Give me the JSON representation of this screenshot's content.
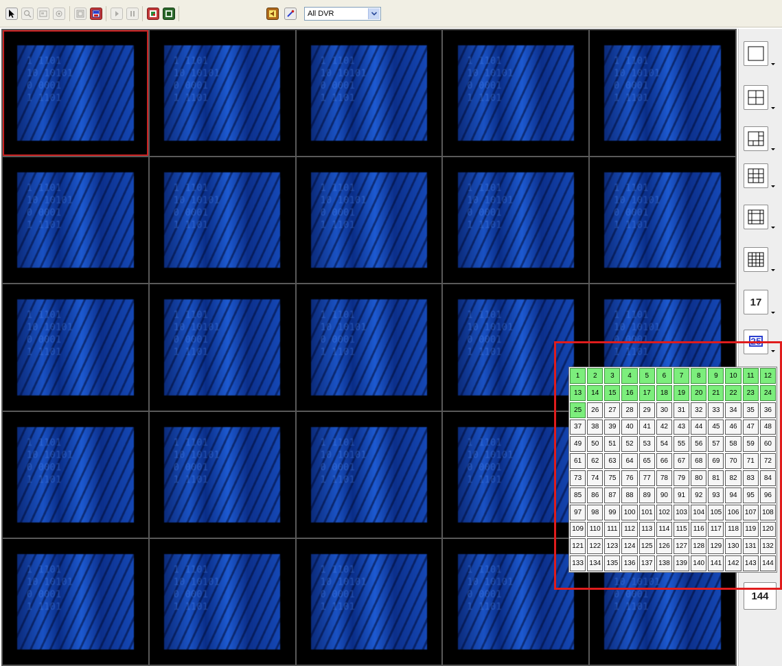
{
  "toolbar": {
    "buttons": [
      {
        "name": "select-pointer-icon",
        "state": "active"
      },
      {
        "name": "zoom-icon",
        "state": "disabled"
      },
      {
        "name": "snapshot-icon",
        "state": "disabled"
      },
      {
        "name": "ptz-icon",
        "state": "disabled"
      },
      {
        "name": "full-screen-icon",
        "state": "disabled"
      },
      {
        "name": "multi-screen-icon",
        "state": "active"
      },
      {
        "name": "play-icon",
        "state": "disabled"
      },
      {
        "name": "pause-icon",
        "state": "disabled"
      },
      {
        "name": "record-icon",
        "state": "active"
      },
      {
        "name": "save-icon",
        "state": "active"
      },
      {
        "name": "audio-icon",
        "state": "active"
      },
      {
        "name": "settings-icon",
        "state": "active"
      }
    ],
    "dvr_select": {
      "value": "All DVR"
    }
  },
  "camera_grid": {
    "rows": 5,
    "columns": 5,
    "selected_cell": 1,
    "feed_text": "1 1101\n10 10101\n0 0001\n1 1101"
  },
  "layout_panel": {
    "buttons": [
      {
        "name": "layout-1-button",
        "icon": "single-view-icon"
      },
      {
        "name": "layout-4-button",
        "icon": "quad-view-icon"
      },
      {
        "name": "layout-6-button",
        "icon": "six-view-icon"
      },
      {
        "name": "layout-9-button",
        "icon": "nine-view-icon"
      },
      {
        "name": "layout-13-button",
        "icon": "thirteen-view-icon"
      },
      {
        "name": "layout-16-button",
        "icon": "sixteen-view-icon"
      },
      {
        "name": "layout-17-button",
        "label": "17"
      },
      {
        "name": "layout-25-button",
        "label": "25"
      },
      {
        "name": "layout-144-button",
        "label": "144"
      }
    ]
  },
  "channel_picker": {
    "columns": 12,
    "active_count": 25,
    "channels": [
      "1",
      "2",
      "3",
      "4",
      "5",
      "6",
      "7",
      "8",
      "9",
      "10",
      "11",
      "12",
      "13",
      "14",
      "15",
      "16",
      "17",
      "18",
      "19",
      "20",
      "21",
      "22",
      "23",
      "24",
      "25",
      "26",
      "27",
      "28",
      "29",
      "30",
      "31",
      "32",
      "33",
      "34",
      "35",
      "36",
      "37",
      "38",
      "39",
      "40",
      "41",
      "42",
      "43",
      "44",
      "45",
      "46",
      "47",
      "48",
      "49",
      "50",
      "51",
      "52",
      "53",
      "54",
      "55",
      "56",
      "57",
      "58",
      "59",
      "60",
      "61",
      "62",
      "63",
      "64",
      "65",
      "66",
      "67",
      "68",
      "69",
      "70",
      "71",
      "72",
      "73",
      "74",
      "75",
      "76",
      "77",
      "78",
      "79",
      "80",
      "81",
      "82",
      "83",
      "84",
      "85",
      "86",
      "87",
      "88",
      "89",
      "90",
      "91",
      "92",
      "93",
      "94",
      "95",
      "96",
      "97",
      "98",
      "99",
      "100",
      "101",
      "102",
      "103",
      "104",
      "105",
      "106",
      "107",
      "108",
      "109",
      "110",
      "111",
      "112",
      "113",
      "114",
      "115",
      "116",
      "117",
      "118",
      "119",
      "120",
      "121",
      "122",
      "123",
      "124",
      "125",
      "126",
      "127",
      "128",
      "129",
      "130",
      "131",
      "132",
      "133",
      "134",
      "135",
      "136",
      "137",
      "138",
      "139",
      "140",
      "141",
      "142",
      "143",
      "144"
    ]
  },
  "colors": {
    "highlight_frame": "#e01c1c",
    "selected_cell_border": "#cc2222",
    "active_channel": "#7cee7c"
  }
}
